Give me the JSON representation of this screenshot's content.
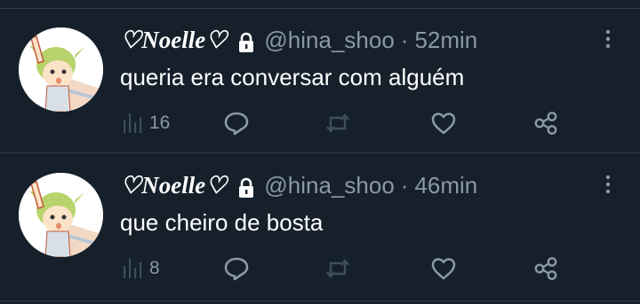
{
  "tweets": [
    {
      "display_name": "♡Noelle♡",
      "handle": "@hina_shoo",
      "separator": "·",
      "time": "52min",
      "text": "queria era conversar com alguém",
      "views": "16"
    },
    {
      "display_name": "♡Noelle♡",
      "handle": "@hina_shoo",
      "separator": "·",
      "time": "46min",
      "text": "que cheiro de bosta",
      "views": "8"
    }
  ],
  "colors": {
    "background": "#15202b",
    "text_primary": "#ffffff",
    "text_secondary": "#8b98a5",
    "icon_muted": "#3e4e5e",
    "divider": "#2f3b47"
  },
  "icons": {
    "lock": "lock-icon",
    "more": "more-icon",
    "views": "bar-chart-icon",
    "reply": "reply-icon",
    "retweet": "retweet-icon",
    "like": "heart-icon",
    "share": "share-icon"
  }
}
